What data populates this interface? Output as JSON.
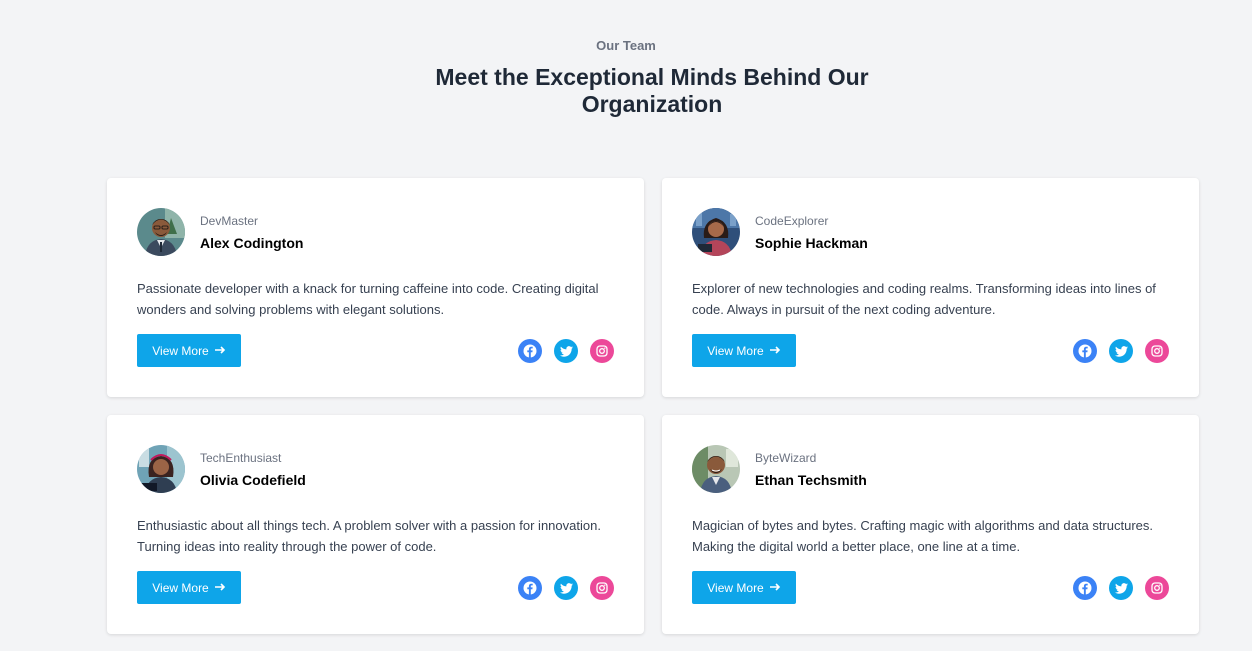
{
  "header": {
    "eyebrow": "Our Team",
    "headline": "Meet the Exceptional Minds Behind Our Organization"
  },
  "members": [
    {
      "handle": "DevMaster",
      "name": "Alex Codington",
      "bio": "Passionate developer with a knack for turning caffeine into code. Creating digital wonders and solving problems with elegant solutions.",
      "button": "View More"
    },
    {
      "handle": "CodeExplorer",
      "name": "Sophie Hackman",
      "bio": "Explorer of new technologies and coding realms. Transforming ideas into lines of code. Always in pursuit of the next coding adventure.",
      "button": "View More"
    },
    {
      "handle": "TechEnthusiast",
      "name": "Olivia Codefield",
      "bio": "Enthusiastic about all things tech. A problem solver with a passion for innovation. Turning ideas into reality through the power of code.",
      "button": "View More"
    },
    {
      "handle": "ByteWizard",
      "name": "Ethan Techsmith",
      "bio": "Magician of bytes and bytes. Crafting magic with algorithms and data structures. Making the digital world a better place, one line at a time.",
      "button": "View More"
    }
  ],
  "icons": {
    "arrow": "arrow-right-icon",
    "social": [
      "facebook-icon",
      "twitter-icon",
      "instagram-icon"
    ]
  },
  "colors": {
    "background": "#f3f4f6",
    "button": "#0ea5e9",
    "facebook": "#3b82f6",
    "twitter": "#0ea5e9",
    "instagram": "#ec4899"
  }
}
